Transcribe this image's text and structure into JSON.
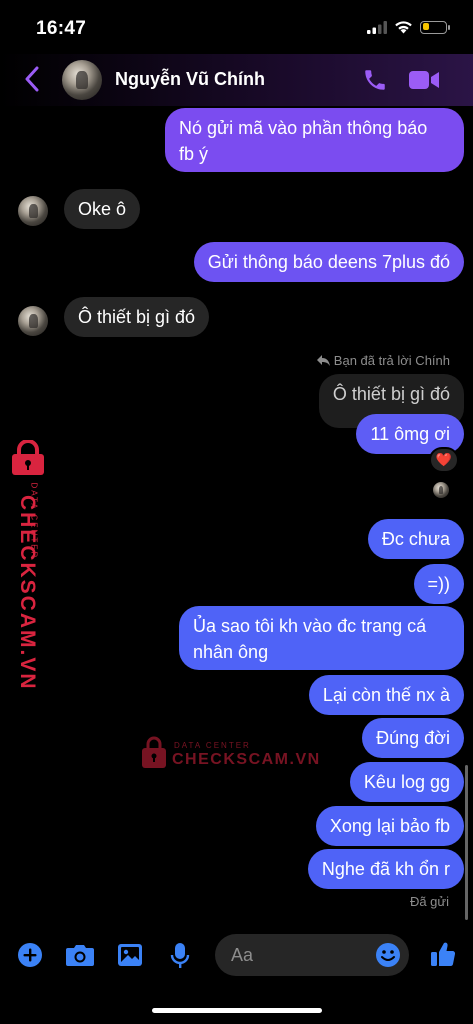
{
  "status_bar": {
    "time": "16:47",
    "battery_level": 0.3,
    "battery_color": "#f5c400"
  },
  "header": {
    "contact_name": "Nguyễn Vũ Chính",
    "accent": "#9b5cf6"
  },
  "messages": [
    {
      "from": "me",
      "lines": [
        "Nó gửi mã vào phần thông báo",
        "fb ý"
      ]
    },
    {
      "from": "contact",
      "text": "Oke ô"
    },
    {
      "from": "me",
      "text": "Gửi thông báo deens 7plus đó"
    },
    {
      "from": "contact",
      "text": "Ô thiết bị gì đó"
    },
    {
      "from": "me",
      "reply_label": "Bạn đã trả lời Chính",
      "quoted": "Ô thiết bị gì đó",
      "text": "11 ômg ơi",
      "reaction": "❤️"
    },
    {
      "from": "me",
      "text": "Đc chưa"
    },
    {
      "from": "me",
      "text": "=))"
    },
    {
      "from": "me",
      "lines": [
        "Ủa sao tôi kh vào đc trang cá",
        "nhân ông"
      ]
    },
    {
      "from": "me",
      "text": "Lại còn thế nx à"
    },
    {
      "from": "me",
      "text": "Đúng đời"
    },
    {
      "from": "me",
      "text": "Kêu log gg"
    },
    {
      "from": "me",
      "text": "Xong lại bảo fb"
    },
    {
      "from": "me",
      "text": "Nghe đã kh ổn r",
      "status": "Đã gửi"
    }
  ],
  "watermark": {
    "brand": "CHECKSCAM.VN",
    "sub": "DATA CENTER",
    "color": "#d9243f"
  },
  "composer": {
    "placeholder": "Aa"
  },
  "colors": {
    "outgoing_purple": "#7b4cf0",
    "outgoing_blue": "#4f63f7",
    "incoming": "#262626",
    "icon_blue": "#3b82f6"
  }
}
